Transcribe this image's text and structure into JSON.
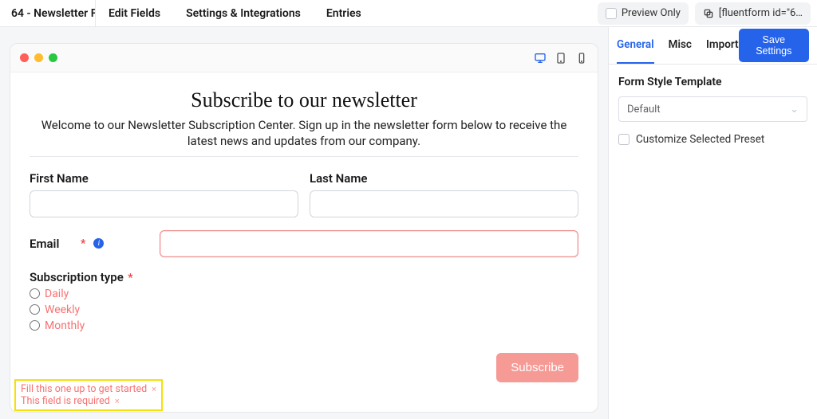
{
  "topbar": {
    "form_title": "64 - Newsletter F…",
    "nav": {
      "edit_fields": "Edit Fields",
      "settings_integrations": "Settings & Integrations",
      "entries": "Entries"
    },
    "preview_only": "Preview Only",
    "shortcode": "[fluentform id=\"6…"
  },
  "preview": {
    "headline": "Subscribe to our newsletter",
    "subhead": "Welcome to our Newsletter Subscription Center. Sign up in the newsletter form below to receive the latest news and updates from our company.",
    "first_name_label": "First Name",
    "last_name_label": "Last Name",
    "email_label": "Email",
    "subscription_label": "Subscription type",
    "subscription_options": {
      "daily": "Daily",
      "weekly": "Weekly",
      "monthly": "Monthly"
    },
    "subscribe_btn": "Subscribe",
    "error1": "Fill this one up to get started",
    "error2": "This field is required"
  },
  "side": {
    "tabs": {
      "general": "General",
      "misc": "Misc",
      "import": "Import"
    },
    "save": "Save Settings",
    "template_label": "Form Style Template",
    "template_value": "Default",
    "customize_preset": "Customize Selected Preset"
  }
}
